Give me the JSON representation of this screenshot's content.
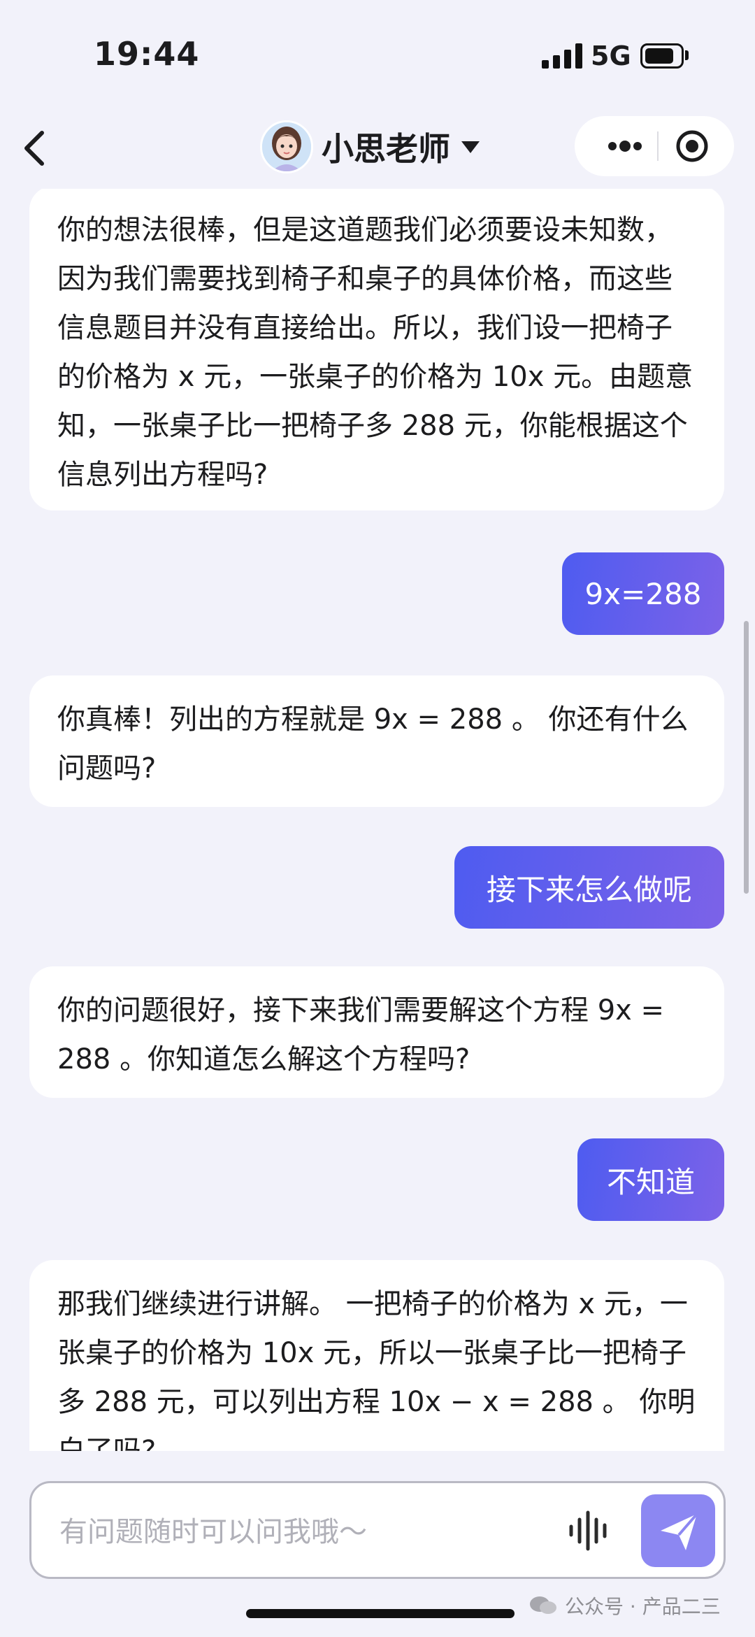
{
  "status_bar": {
    "time": "19:44",
    "network": "5G"
  },
  "nav": {
    "title": "小思老师"
  },
  "messages": [
    {
      "role": "assistant",
      "text": "你的想法很棒，但是这道题我们必须要设未知数，因为我们需要找到椅子和桌子的具体价格，而这些信息题目并没有直接给出。所以，我们设一把椅子的价格为 x 元，一张桌子的价格为 10x 元。由题意知，一张桌子比一把椅子多 288 元，你能根据这个信息列出方程吗?"
    },
    {
      "role": "user",
      "text": "9x=288"
    },
    {
      "role": "assistant",
      "text": "你真棒！列出的方程就是 9x = 288 。 你还有什么问题吗?"
    },
    {
      "role": "user",
      "text": "接下来怎么做呢"
    },
    {
      "role": "assistant",
      "text": "你的问题很好，接下来我们需要解这个方程 9x = 288 。你知道怎么解这个方程吗?"
    },
    {
      "role": "user",
      "text": "不知道"
    },
    {
      "role": "assistant",
      "text": "那我们继续进行讲解。 一把椅子的价格为 x 元，一张桌子的价格为 10x 元，所以一张桌子比一把椅子多 288 元，可以列出方程 10x − x = 288 。 你明白了吗?"
    }
  ],
  "input": {
    "placeholder": "有问题随时可以问我哦～",
    "value": ""
  },
  "watermark": "公众号 · 产品二三",
  "colors": {
    "user_bubble_start": "#4e5cf0",
    "user_bubble_end": "#7c62e8",
    "send_button": "#8c87f2",
    "background": "#f2f2fa"
  },
  "icons": [
    "back-chevron-icon",
    "avatar",
    "dropdown-caret-icon",
    "more-dots-icon",
    "target-icon",
    "voice-wave-icon",
    "send-paper-plane-icon",
    "wechat-icon"
  ]
}
